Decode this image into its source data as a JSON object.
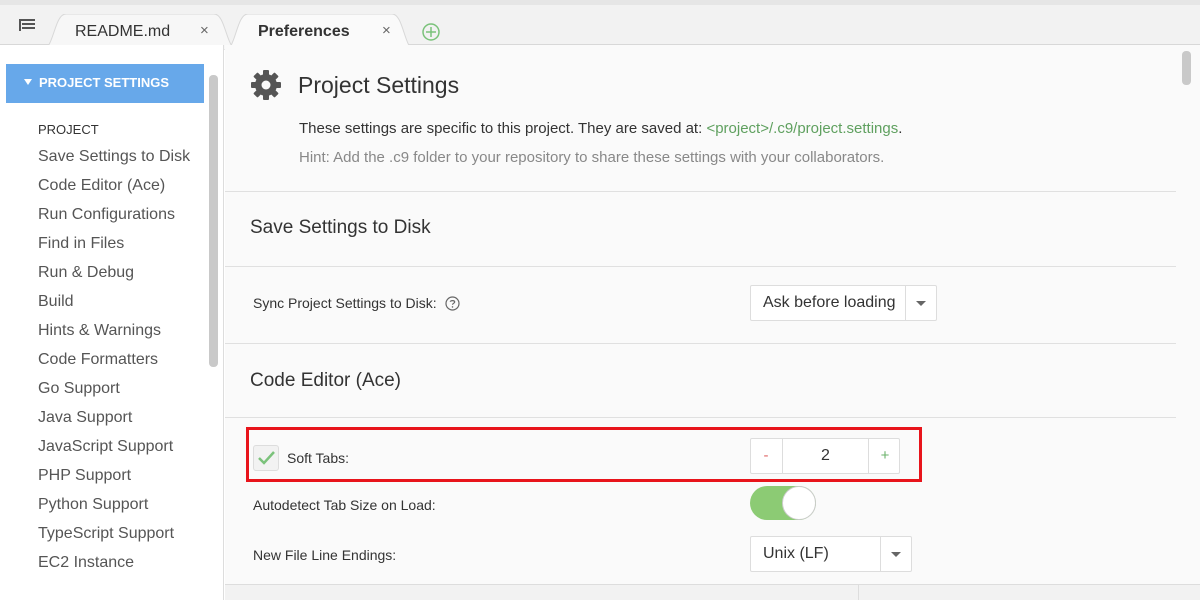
{
  "tabs": [
    {
      "label": "README.md",
      "close": "×"
    },
    {
      "label": "Preferences",
      "close": "×"
    }
  ],
  "sidebar": {
    "header": "PROJECT SETTINGS",
    "section": "PROJECT",
    "items": [
      "Save Settings to Disk",
      "Code Editor (Ace)",
      "Run Configurations",
      "Find in Files",
      "Run & Debug",
      "Build",
      "Hints & Warnings",
      "Code Formatters",
      "Go Support",
      "Java Support",
      "JavaScript Support",
      "PHP Support",
      "Python Support",
      "TypeScript Support",
      "EC2 Instance"
    ]
  },
  "main": {
    "title": "Project Settings",
    "intro_text": "These settings are specific to this project. They are saved at: ",
    "intro_path": "<project>/.c9/project.settings",
    "intro_end": ".",
    "hint": "Hint: Add the .c9 folder to your repository to share these settings with your collaborators.",
    "save_section": {
      "title": "Save Settings to Disk",
      "sync_label": "Sync Project Settings to Disk:",
      "sync_value": "Ask before loading"
    },
    "editor_section": {
      "title": "Code Editor (Ace)",
      "soft_tabs_label": "Soft Tabs:",
      "soft_tabs_checked": true,
      "soft_tabs_value": "2",
      "minus": "-",
      "plus": "+",
      "autodetect_label": "Autodetect Tab Size on Load:",
      "autodetect_on": true,
      "line_endings_label": "New File Line Endings:",
      "line_endings_value": "Unix (LF)"
    }
  },
  "colors": {
    "accent": "#67a8ea",
    "highlight": "#e8141b",
    "toggle_on": "#8ccb74",
    "path": "#5fa05f"
  }
}
